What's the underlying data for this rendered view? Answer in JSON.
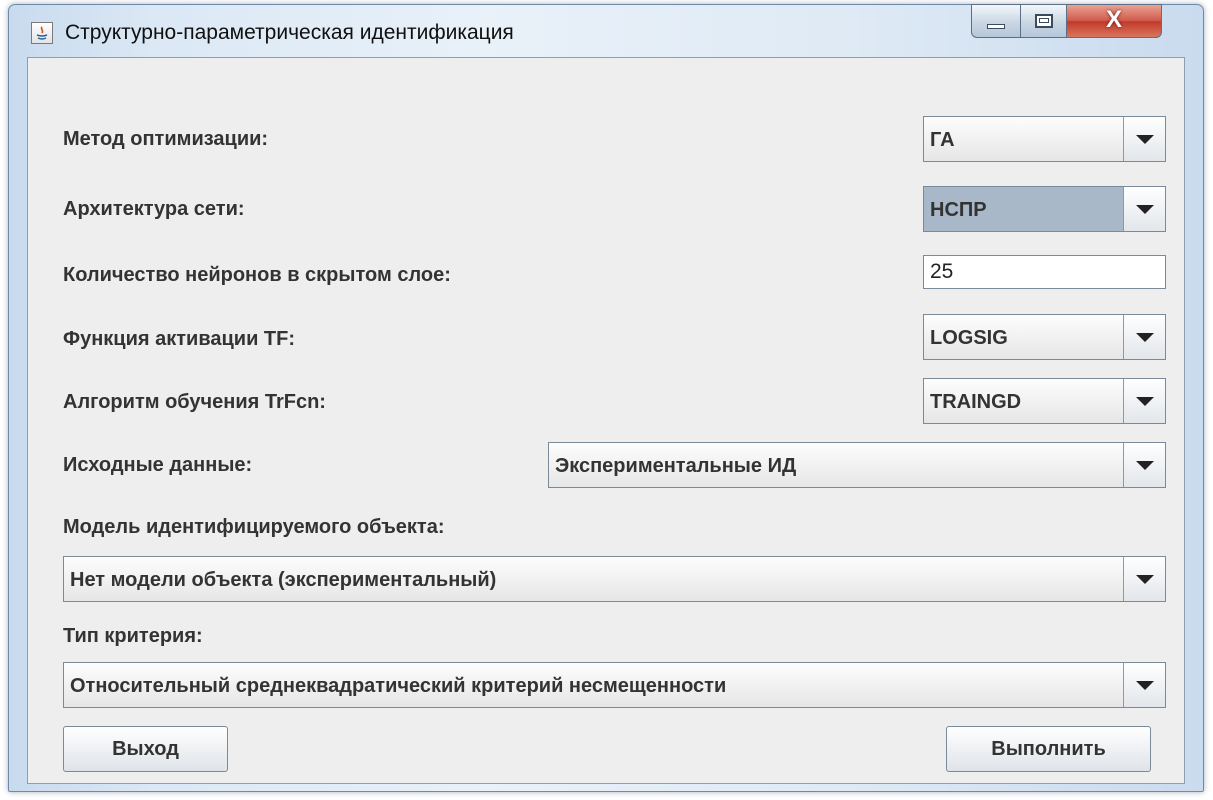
{
  "window": {
    "title": "Структурно-параметрическая идентификация",
    "close_glyph": "X"
  },
  "form": {
    "optimization_method": {
      "label": "Метод оптимизации:",
      "value": "ГА"
    },
    "network_architecture": {
      "label": "Архитектура сети:",
      "value": "НСПР"
    },
    "hidden_neurons": {
      "label": "Количество нейронов в скрытом слое:",
      "value": "25"
    },
    "activation_function": {
      "label": "Функция активации TF:",
      "value": "LOGSIG"
    },
    "training_algorithm": {
      "label": "Алгоритм обучения TrFcn:",
      "value": "TRAINGD"
    },
    "source_data": {
      "label": "Исходные данные:",
      "value": "Экспериментальные ИД"
    },
    "object_model": {
      "label": "Модель идентифицируемого объекта:",
      "value": "Нет модели объекта (экспериментальный)"
    },
    "criterion_type": {
      "label": "Тип критерия:",
      "value": "Относительный среднеквадратический критерий несмещенности"
    }
  },
  "buttons": {
    "exit": "Выход",
    "run": "Выполнить"
  }
}
